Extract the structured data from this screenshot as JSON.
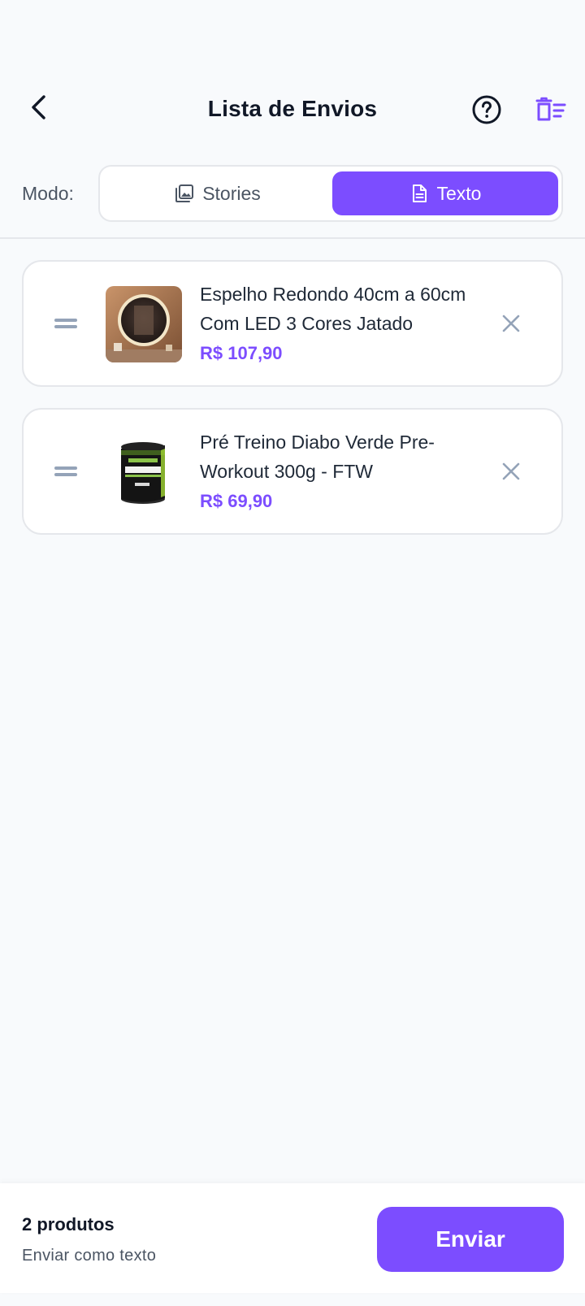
{
  "header": {
    "title": "Lista de Envios",
    "back_icon": "chevron-left-icon",
    "help_icon": "help-circle-icon",
    "clear_icon": "clear-list-icon"
  },
  "mode": {
    "label": "Modo:",
    "options": [
      {
        "label": "Stories",
        "icon": "image-stack-icon",
        "selected": false
      },
      {
        "label": "Texto",
        "icon": "document-icon",
        "selected": true
      }
    ]
  },
  "products": [
    {
      "name": "Espelho Redondo 40cm a 60cm Com LED 3 Cores Jatado",
      "price": "R$ 107,90"
    },
    {
      "name": "Pré Treino Diabo Verde Pre-Workout 300g - FTW",
      "price": "R$ 69,90"
    }
  ],
  "footer": {
    "count": "2 produtos",
    "send_mode": "Enviar como texto",
    "send_label": "Enviar"
  },
  "colors": {
    "accent": "#7c4dff",
    "background": "#f8fafc",
    "text": "#111827",
    "muted": "#94a3b8"
  }
}
